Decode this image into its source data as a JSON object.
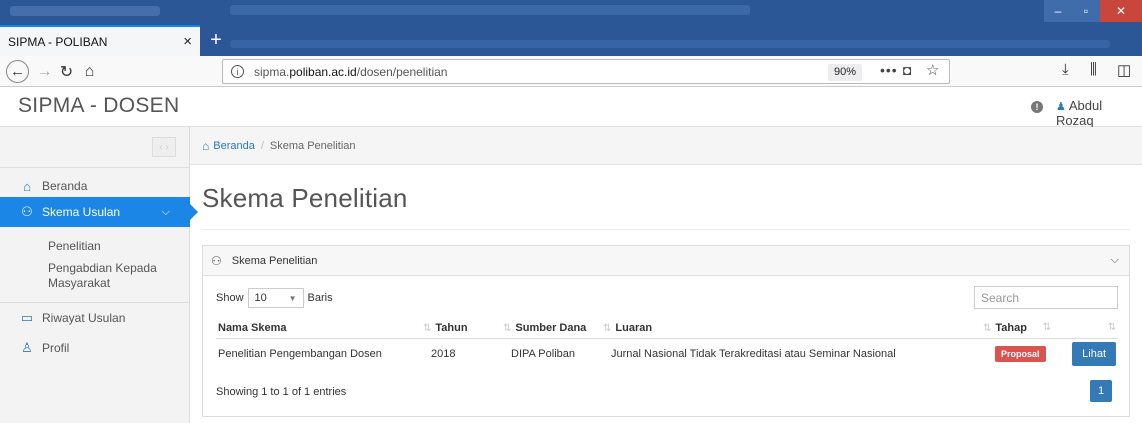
{
  "browser": {
    "tab_title": "SIPMA - POLIBAN",
    "tab_close": "×",
    "new_tab": "+",
    "url_prefix": "sipma.",
    "url_domain": "poliban.ac.id",
    "url_path": "/dosen/penelitian",
    "zoom": "90%",
    "icons": [
      "back-arrow-icon",
      "forward-arrow-icon",
      "reload-icon",
      "home-icon",
      "info-icon",
      "more-dots-icon",
      "pocket-icon",
      "star-icon",
      "download-icon",
      "library-icon",
      "sidebar-icon"
    ]
  },
  "header": {
    "brand": "SIPMA - DOSEN",
    "user_name": "Abdul Rozaq"
  },
  "sidebar": {
    "items": [
      {
        "label": "Beranda"
      },
      {
        "label": "Skema Usulan"
      },
      {
        "label": "Riwayat Usulan"
      },
      {
        "label": "Profil"
      }
    ],
    "subitems": [
      {
        "label": "Penelitian"
      },
      {
        "label": "Pengabdian Kepada Masyarakat"
      }
    ]
  },
  "breadcrumb": {
    "home": "Beranda",
    "sep": "/",
    "current": "Skema Penelitian"
  },
  "page": {
    "title": "Skema Penelitian"
  },
  "panel": {
    "title": "Skema Penelitian",
    "show_label": "Show",
    "length_value": "10",
    "rows_label": "Baris",
    "search_placeholder": "Search",
    "columns": [
      "Nama Skema",
      "Tahun",
      "Sumber Dana",
      "Luaran",
      "Tahap"
    ],
    "rows": [
      {
        "nama": "Penelitian Pengembangan Dosen",
        "tahun": "2018",
        "sumber": "DIPA Poliban",
        "luaran": "Jurnal Nasional Tidak Terakreditasi atau Seminar Nasional",
        "tahap": "Proposal",
        "action": "Lihat"
      }
    ],
    "info": "Showing 1 to 1 of 1 entries",
    "page": "1"
  },
  "colors": {
    "accent": "#1b86e5",
    "primary_button": "#337ab7",
    "danger_badge": "#d9534f",
    "titlebar": "#2b5797"
  }
}
